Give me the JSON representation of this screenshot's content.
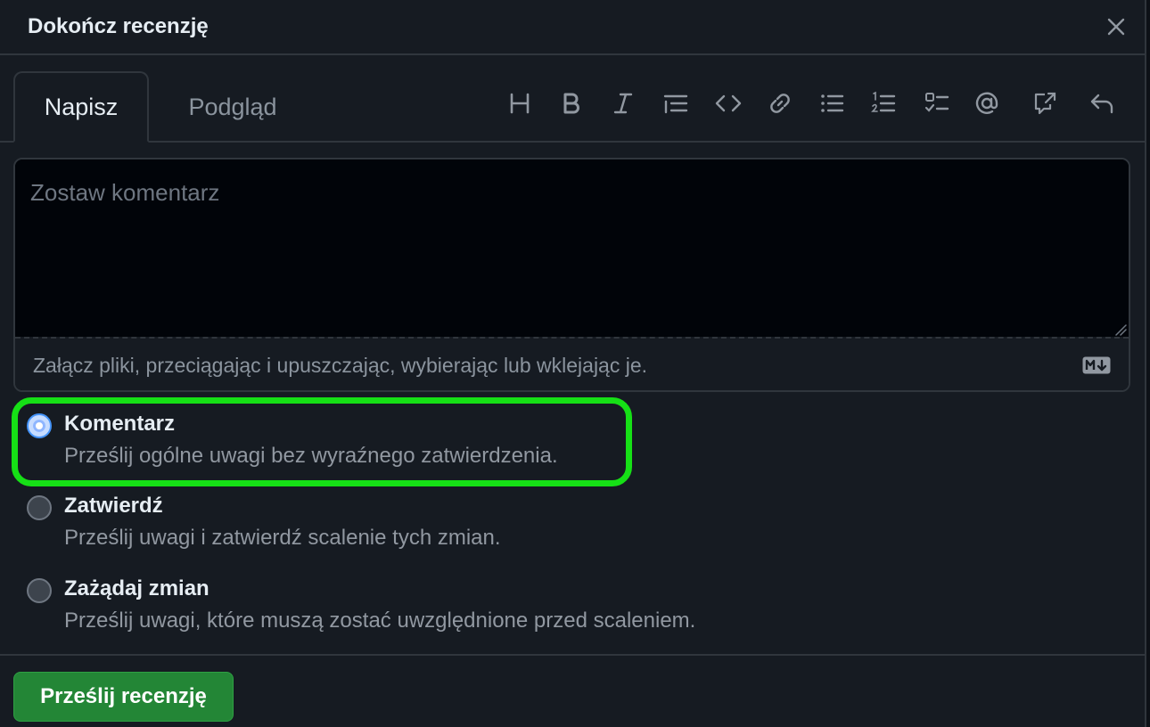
{
  "dialog": {
    "title": "Dokończ recenzję",
    "close_icon": "close-icon"
  },
  "tabs": [
    {
      "label": "Napisz",
      "active": true
    },
    {
      "label": "Podgląd",
      "active": false
    }
  ],
  "toolbar": [
    {
      "icon": "heading-icon"
    },
    {
      "icon": "bold-icon"
    },
    {
      "icon": "italic-icon"
    },
    {
      "icon": "quote-icon"
    },
    {
      "icon": "code-icon"
    },
    {
      "icon": "link-icon"
    },
    {
      "icon": "unordered-list-icon"
    },
    {
      "icon": "ordered-list-icon"
    },
    {
      "icon": "task-list-icon"
    },
    {
      "icon": "mention-icon"
    },
    {
      "icon": "cross-reference-icon"
    },
    {
      "icon": "reply-icon"
    }
  ],
  "editor": {
    "placeholder": "Zostaw komentarz",
    "value": "",
    "attach_hint": "Załącz pliki, przeciągając i upuszczając, wybierając lub wklejając je.",
    "markdown_icon": "markdown-icon"
  },
  "review_options": [
    {
      "title": "Komentarz",
      "description": "Prześlij ogólne uwagi bez wyraźnego zatwierdzenia.",
      "selected": true
    },
    {
      "title": "Zatwierdź",
      "description": "Prześlij uwagi i zatwierdź scalenie tych zmian.",
      "selected": false
    },
    {
      "title": "Zażądaj zmian",
      "description": "Prześlij uwagi, które muszą zostać uwzględnione przed scaleniem.",
      "selected": false
    }
  ],
  "footer": {
    "submit_label": "Prześlij recenzję"
  },
  "colors": {
    "background": "#161b22",
    "border": "#30363d",
    "primary_button": "#238636",
    "highlight": "#16e016",
    "radio_selected": "#4493f8"
  }
}
